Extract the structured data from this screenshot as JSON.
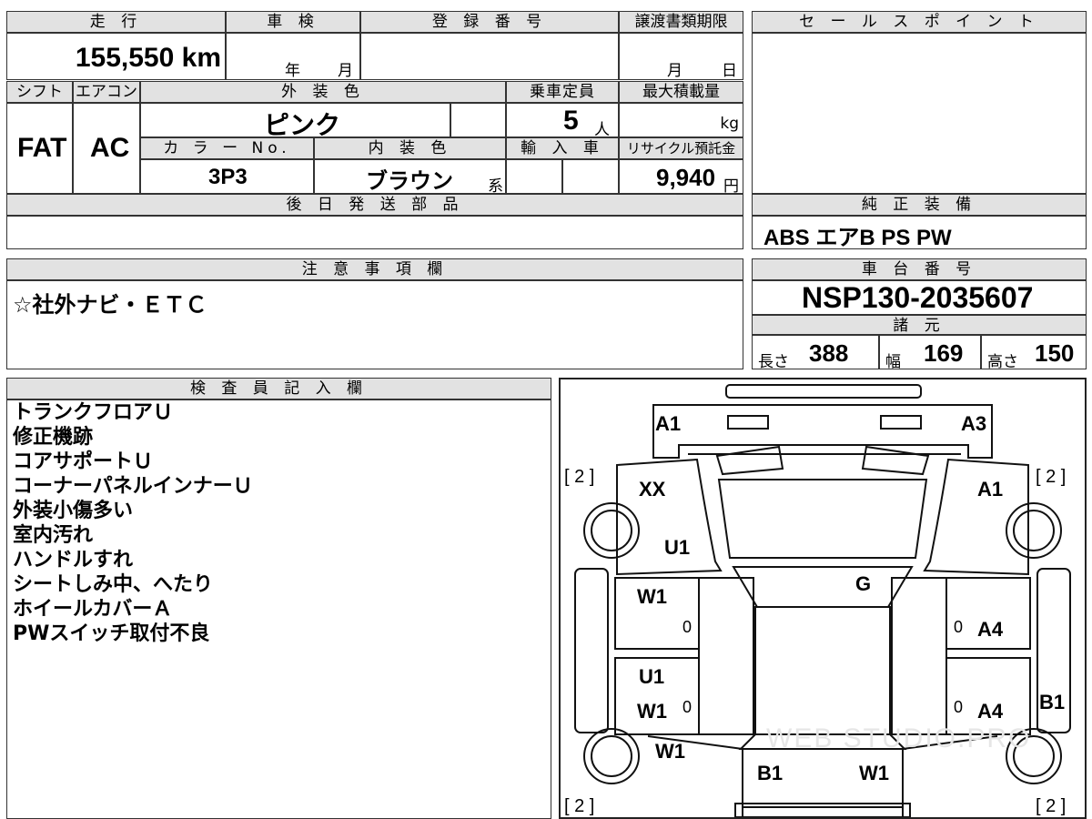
{
  "top": {
    "mileage_label": "走 行",
    "mileage": "155,550 km",
    "shaken_label": "車 検",
    "shaken_year": "年",
    "shaken_month": "月",
    "reg_label": "登 録 番 号",
    "transfer_label": "譲渡書類期限",
    "transfer_month": "月",
    "transfer_day": "日",
    "shift_label": "シフト",
    "shift": "FAT",
    "ac_label": "エアコン",
    "ac": "AC",
    "color_label": "外 装 色",
    "color": "ピンク",
    "capacity_label": "乗車定員",
    "capacity": "5",
    "capacity_unit": "人",
    "maxload_label": "最大積載量",
    "maxload_unit": "kg",
    "colorno_label": "カ ラ ー No.",
    "colorno": "3P3",
    "interior_label": "内 装 色",
    "interior": "ブラウン",
    "interior_suffix": "系",
    "import_label": "輸 入 車",
    "recycle_label": "リサイクル預託金",
    "recycle": "9,940",
    "recycle_unit": "円",
    "later_parts_label": "後 日 発 送 部 品"
  },
  "sales": {
    "label": "セ ー ル ス ポ イ ン ト"
  },
  "equipment": {
    "label": "純 正 装 備",
    "value": "ABS エアB PS PW"
  },
  "caution": {
    "label": "注 意 事 項 欄",
    "value": "☆社外ナビ・ＥＴＣ"
  },
  "chassis": {
    "label": "車 台 番 号",
    "value": "NSP130-2035607",
    "spec_label": "諸 元",
    "length_label": "長さ",
    "length": "388",
    "width_label": "幅",
    "width": "169",
    "height_label": "高さ",
    "height": "150"
  },
  "inspector": {
    "label": "検 査 員 記 入 欄",
    "notes": [
      "トランクフロアＵ",
      "修正機跡",
      "コアサポートＵ",
      "コーナーパネルインナーＵ",
      "外装小傷多い",
      "室内汚れ",
      "ハンドルすれ",
      "シートしみ中、へたり",
      "ホイールカバーＡ",
      "PWスイッチ取付不良"
    ]
  },
  "diagram": {
    "labels": {
      "front_left": "A1",
      "front_right": "A3",
      "tire_fl": "[ 2 ]",
      "tire_fr": "[ 2 ]",
      "tire_rl": "[ 2 ]",
      "tire_rr": "[ 2 ]",
      "fender_left": "XX",
      "fender_right": "A1",
      "pillar_left": "U1",
      "windshield": "G",
      "door_fl": "W1",
      "door_fr": "A4",
      "door_rl_top": "U1",
      "door_rl": "W1",
      "door_rr": "A4",
      "rocker_right": "B1",
      "qtr_left": "W1",
      "rear_left": "B1",
      "rear_right": "W1",
      "z1": "0",
      "z2": "0",
      "z3": "0",
      "z4": "0"
    },
    "watermark": "WEB STUDIO.PRO"
  }
}
